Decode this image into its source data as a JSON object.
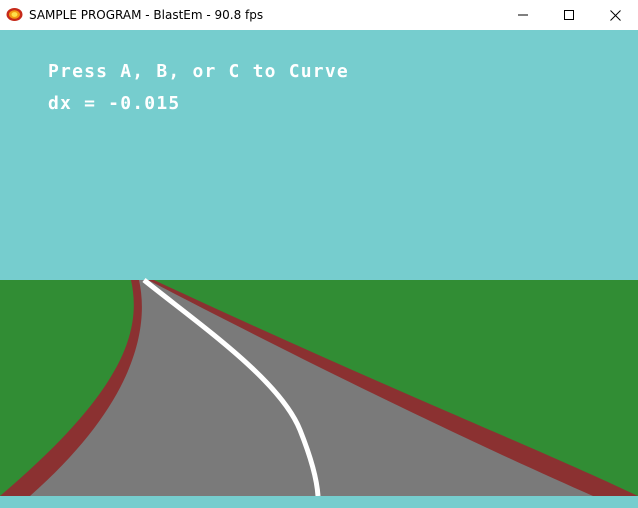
{
  "window": {
    "title": "SAMPLE PROGRAM - BlastEm - 90.8 fps",
    "app_icon": "blastem-icon",
    "controls": {
      "minimize_icon": "minimize-icon",
      "maximize_icon": "maximize-icon",
      "close_icon": "close-icon"
    }
  },
  "game": {
    "instruction": "Press A, B, or C to Curve",
    "dx_readout": "dx = -0.015",
    "colors": {
      "sky": "#76cdce",
      "grass": "#318d34",
      "road": "#7a7a7a",
      "road_edge": "#8b3131",
      "center_line": "#ffffff",
      "text": "#ffffff"
    }
  }
}
